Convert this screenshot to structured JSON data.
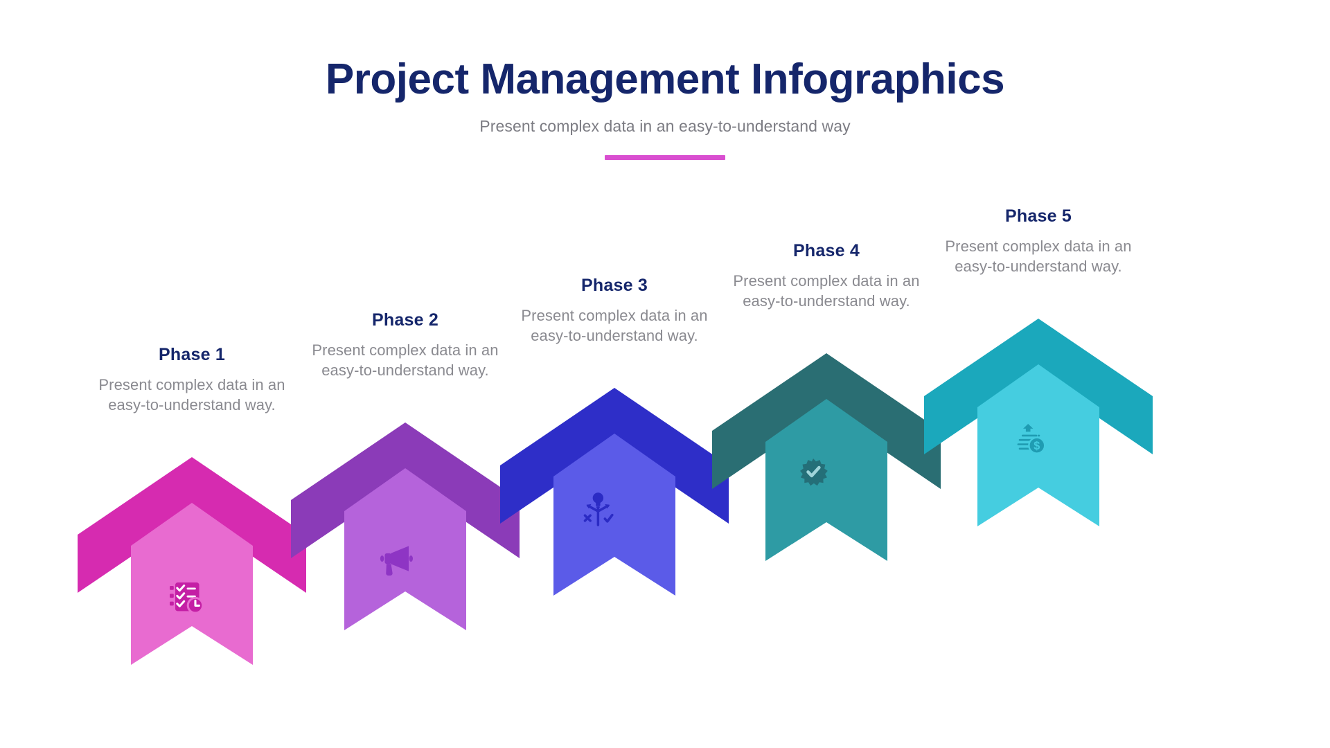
{
  "header": {
    "title": "Project Management Infographics",
    "subtitle": "Present complex data in an easy-to-understand way",
    "divider_color": "#d94fd0",
    "title_color": "#15266b",
    "subtitle_color": "#7c7c83"
  },
  "steps": [
    {
      "title": "Phase 1",
      "description": "Present complex data in an easy-to-understand way.",
      "icon": "checklist-clock-icon",
      "arrow_color": "#d62bb0",
      "ribbon_color": "#e86bd0",
      "icon_color": "#c41fa5"
    },
    {
      "title": "Phase 2",
      "description": "Present complex data in an easy-to-understand way.",
      "icon": "megaphone-icon",
      "arrow_color": "#8b3bb8",
      "ribbon_color": "#b563db",
      "icon_color": "#8e35c4"
    },
    {
      "title": "Phase 3",
      "description": "Present complex data in an easy-to-understand way.",
      "icon": "lightbulb-strategy-icon",
      "arrow_color": "#2e2ec8",
      "ribbon_color": "#5b5be8",
      "icon_color": "#2b2bc4"
    },
    {
      "title": "Phase 4",
      "description": "Present complex data in an easy-to-understand way.",
      "icon": "verified-badge-icon",
      "arrow_color": "#2a6e73",
      "ribbon_color": "#2e9ba4",
      "icon_color": "#246f78"
    },
    {
      "title": "Phase 5",
      "description": "Present complex data in an easy-to-understand way.",
      "icon": "invoice-dollar-icon",
      "arrow_color": "#1ba8bc",
      "ribbon_color": "#45cde0",
      "icon_color": "#1f9cb2"
    }
  ]
}
